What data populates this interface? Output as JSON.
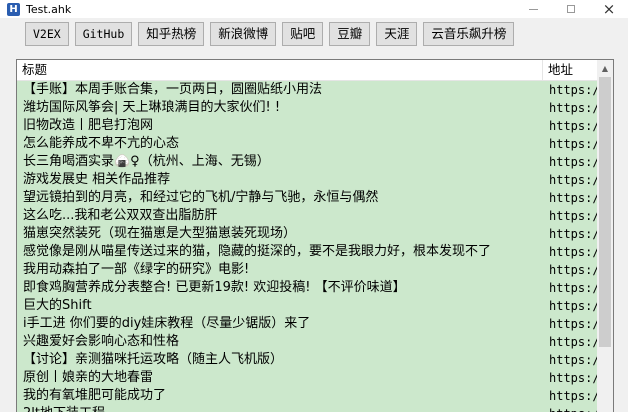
{
  "window": {
    "title": "Test.ahk",
    "icon_letter": "H",
    "icon": "ahk-app-icon",
    "controls": {
      "minimize": "minimize-icon",
      "maximize": "maximize-icon",
      "close": "×"
    }
  },
  "toolbar": {
    "buttons": [
      "V2EX",
      "GitHub",
      "知乎热榜",
      "新浪微博",
      "贴吧",
      "豆瓣",
      "天涯",
      "云音乐飙升榜"
    ]
  },
  "list": {
    "columns": {
      "title": "标题",
      "url": "地址"
    },
    "rows": [
      {
        "title": "【手账】本周手账合集，一页两日，圆圈贴纸小用法",
        "url": "https:/"
      },
      {
        "title": "潍坊国际风筝会| 天上琳琅满目的大家伙们! !",
        "url": "https:/"
      },
      {
        "title": "旧物改造丨肥皂打泡网",
        "url": "https:/"
      },
      {
        "title": "怎么能养成不卑不亢的心态",
        "url": "https:/"
      },
      {
        "title": "长三角喝酒实录🍙♀（杭州、上海、无锡）",
        "url": "https:/"
      },
      {
        "title": "游戏发展史 相关作品推荐",
        "url": "https:/"
      },
      {
        "title": "望远镜拍到的月亮，和经过它的飞机/宁静与飞驰，永恒与偶然",
        "url": "https:/"
      },
      {
        "title": "这么吃...我和老公双双查出脂肪肝",
        "url": "https:/"
      },
      {
        "title": "猫崽突然装死（现在猫崽是大型猫崽装死现场）",
        "url": "https:/"
      },
      {
        "title": "感觉像是刚从喵星传送过来的猫，隐藏的挺深的，要不是我眼力好，根本发现不了",
        "url": "https:/"
      },
      {
        "title": "我用动森拍了一部《绿字的研究》电影!",
        "url": "https:/"
      },
      {
        "title": "即食鸡胸营养成分表整合! 已更新19款! 欢迎投稿! 【不评价味道】",
        "url": "https:/"
      },
      {
        "title": "巨大的Shift",
        "url": "https:/"
      },
      {
        "title": "i手工进 你们要的diy娃床教程（尽量少锯版）来了",
        "url": "https:/"
      },
      {
        "title": "兴趣爱好会影响心态和性格",
        "url": "https:/"
      },
      {
        "title": "【讨论】亲测猫咪托运攻略（随主人飞机版）",
        "url": "https:/"
      },
      {
        "title": "原创丨娘亲的大地春雷",
        "url": "https:/"
      },
      {
        "title": "我的有氧堆肥可能成功了",
        "url": "https:/"
      },
      {
        "title": "2lt地下装工程",
        "url": "https:/"
      }
    ]
  },
  "scrollbar": {
    "up_arrow": "▲",
    "position": 0.0
  }
}
